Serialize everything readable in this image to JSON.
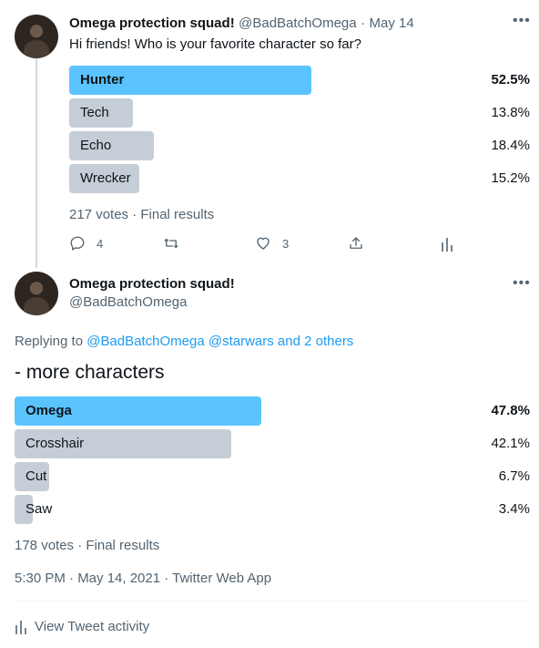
{
  "tweet1": {
    "author_name": "Omega protection squad!",
    "handle": "@BadBatchOmega",
    "separator": "·",
    "date": "May 14",
    "text": "Hi friends! Who is your favorite character so far?",
    "poll": [
      {
        "label": "Hunter",
        "percent_text": "52.5%",
        "percent": 52.5,
        "winner": true
      },
      {
        "label": "Tech",
        "percent_text": "13.8%",
        "percent": 13.8,
        "winner": false
      },
      {
        "label": "Echo",
        "percent_text": "18.4%",
        "percent": 18.4,
        "winner": false
      },
      {
        "label": "Wrecker",
        "percent_text": "15.2%",
        "percent": 15.2,
        "winner": false
      }
    ],
    "poll_meta": "217 votes · Final results",
    "actions": {
      "reply_count": "4",
      "retweet_count": "",
      "like_count": "3"
    }
  },
  "tweet2": {
    "author_name": "Omega protection squad!",
    "handle": "@BadBatchOmega",
    "replying_prefix": "Replying to ",
    "replying_to": "@BadBatchOmega @starwars and 2 others",
    "text": "- more characters",
    "poll": [
      {
        "label": "Omega",
        "percent_text": "47.8%",
        "percent": 47.8,
        "winner": true
      },
      {
        "label": "Crosshair",
        "percent_text": "42.1%",
        "percent": 42.1,
        "winner": false
      },
      {
        "label": "Cut",
        "percent_text": "6.7%",
        "percent": 6.7,
        "winner": false
      },
      {
        "label": "Saw",
        "percent_text": "3.4%",
        "percent": 3.4,
        "winner": false
      }
    ],
    "poll_meta": "178 votes · Final results",
    "timestamp": "5:30 PM · May 14, 2021 · Twitter Web App",
    "activity_label": "View Tweet activity"
  },
  "colors": {
    "accent": "#1d9bf0",
    "winner_bar": "#5bc4ff",
    "bar": "#c5ced6"
  },
  "icons": {
    "more": "ellipsis-icon",
    "reply": "reply-icon",
    "retweet": "retweet-icon",
    "like": "heart-icon",
    "share": "share-icon",
    "analytics": "analytics-icon"
  }
}
